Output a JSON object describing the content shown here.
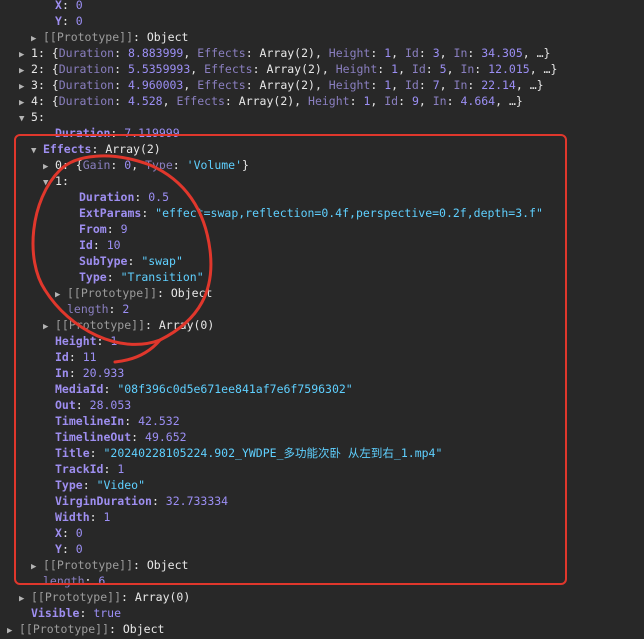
{
  "lines": [
    {
      "parts": [
        [
          "key",
          "X"
        ],
        [
          "txt",
          ": "
        ],
        [
          "num",
          "0"
        ]
      ]
    },
    {
      "parts": [
        [
          "key",
          "Y"
        ],
        [
          "txt",
          ": "
        ],
        [
          "num",
          "0"
        ]
      ]
    },
    {
      "parts": [
        [
          "proto",
          "[[Prototype]]"
        ],
        [
          "txt",
          ": "
        ],
        [
          "obj",
          "Object"
        ]
      ]
    },
    {
      "parts": [
        [
          "idx",
          "1"
        ],
        [
          "txt",
          ": {"
        ],
        [
          "key-dim",
          "Duration"
        ],
        [
          "txt",
          ": "
        ],
        [
          "num",
          "8.883999"
        ],
        [
          "txt",
          ", "
        ],
        [
          "key-dim",
          "Effects"
        ],
        [
          "txt",
          ": "
        ],
        [
          "obj",
          "Array(2)"
        ],
        [
          "txt",
          ", "
        ],
        [
          "key-dim",
          "Height"
        ],
        [
          "txt",
          ": "
        ],
        [
          "num",
          "1"
        ],
        [
          "txt",
          ", "
        ],
        [
          "key-dim",
          "Id"
        ],
        [
          "txt",
          ": "
        ],
        [
          "num",
          "3"
        ],
        [
          "txt",
          ", "
        ],
        [
          "key-dim",
          "In"
        ],
        [
          "txt",
          ": "
        ],
        [
          "num",
          "34.305"
        ],
        [
          "txt",
          ", …}"
        ]
      ]
    },
    {
      "parts": [
        [
          "idx",
          "2"
        ],
        [
          "txt",
          ": {"
        ],
        [
          "key-dim",
          "Duration"
        ],
        [
          "txt",
          ": "
        ],
        [
          "num",
          "5.5359993"
        ],
        [
          "txt",
          ", "
        ],
        [
          "key-dim",
          "Effects"
        ],
        [
          "txt",
          ": "
        ],
        [
          "obj",
          "Array(2)"
        ],
        [
          "txt",
          ", "
        ],
        [
          "key-dim",
          "Height"
        ],
        [
          "txt",
          ": "
        ],
        [
          "num",
          "1"
        ],
        [
          "txt",
          ", "
        ],
        [
          "key-dim",
          "Id"
        ],
        [
          "txt",
          ": "
        ],
        [
          "num",
          "5"
        ],
        [
          "txt",
          ", "
        ],
        [
          "key-dim",
          "In"
        ],
        [
          "txt",
          ": "
        ],
        [
          "num",
          "12.015"
        ],
        [
          "txt",
          ", …}"
        ]
      ]
    },
    {
      "parts": [
        [
          "idx",
          "3"
        ],
        [
          "txt",
          ": {"
        ],
        [
          "key-dim",
          "Duration"
        ],
        [
          "txt",
          ": "
        ],
        [
          "num",
          "4.960003"
        ],
        [
          "txt",
          ", "
        ],
        [
          "key-dim",
          "Effects"
        ],
        [
          "txt",
          ": "
        ],
        [
          "obj",
          "Array(2)"
        ],
        [
          "txt",
          ", "
        ],
        [
          "key-dim",
          "Height"
        ],
        [
          "txt",
          ": "
        ],
        [
          "num",
          "1"
        ],
        [
          "txt",
          ", "
        ],
        [
          "key-dim",
          "Id"
        ],
        [
          "txt",
          ": "
        ],
        [
          "num",
          "7"
        ],
        [
          "txt",
          ", "
        ],
        [
          "key-dim",
          "In"
        ],
        [
          "txt",
          ": "
        ],
        [
          "num",
          "22.14"
        ],
        [
          "txt",
          ", …}"
        ]
      ]
    },
    {
      "parts": [
        [
          "idx",
          "4"
        ],
        [
          "txt",
          ": {"
        ],
        [
          "key-dim",
          "Duration"
        ],
        [
          "txt",
          ": "
        ],
        [
          "num",
          "4.528"
        ],
        [
          "txt",
          ", "
        ],
        [
          "key-dim",
          "Effects"
        ],
        [
          "txt",
          ": "
        ],
        [
          "obj",
          "Array(2)"
        ],
        [
          "txt",
          ", "
        ],
        [
          "key-dim",
          "Height"
        ],
        [
          "txt",
          ": "
        ],
        [
          "num",
          "1"
        ],
        [
          "txt",
          ", "
        ],
        [
          "key-dim",
          "Id"
        ],
        [
          "txt",
          ": "
        ],
        [
          "num",
          "9"
        ],
        [
          "txt",
          ", "
        ],
        [
          "key-dim",
          "In"
        ],
        [
          "txt",
          ": "
        ],
        [
          "num",
          "4.664"
        ],
        [
          "txt",
          ", …}"
        ]
      ]
    },
    {
      "parts": [
        [
          "idx",
          "5"
        ],
        [
          "txt",
          ":"
        ]
      ]
    },
    {
      "parts": [
        [
          "key",
          "Duration"
        ],
        [
          "txt",
          ": "
        ],
        [
          "num",
          "7.119999"
        ]
      ]
    },
    {
      "parts": [
        [
          "key",
          "Effects"
        ],
        [
          "txt",
          ": "
        ],
        [
          "obj",
          "Array(2)"
        ]
      ]
    },
    {
      "parts": [
        [
          "idx",
          "0"
        ],
        [
          "txt",
          ": {"
        ],
        [
          "key-dim",
          "Gain"
        ],
        [
          "txt",
          ": "
        ],
        [
          "num",
          "0"
        ],
        [
          "txt",
          ", "
        ],
        [
          "key-dim",
          "Type"
        ],
        [
          "txt",
          ": "
        ],
        [
          "str",
          "'Volume'"
        ],
        [
          "txt",
          "}"
        ]
      ]
    },
    {
      "parts": [
        [
          "idx",
          "1"
        ],
        [
          "txt",
          ":"
        ]
      ]
    },
    {
      "parts": [
        [
          "key",
          "Duration"
        ],
        [
          "txt",
          ": "
        ],
        [
          "num",
          "0.5"
        ]
      ]
    },
    {
      "parts": [
        [
          "key",
          "ExtParams"
        ],
        [
          "txt",
          ": "
        ],
        [
          "str",
          "\"effect=swap,reflection=0.4f,perspective=0.2f,depth=3.f\""
        ]
      ]
    },
    {
      "parts": [
        [
          "key",
          "From"
        ],
        [
          "txt",
          ": "
        ],
        [
          "num",
          "9"
        ]
      ]
    },
    {
      "parts": [
        [
          "key",
          "Id"
        ],
        [
          "txt",
          ": "
        ],
        [
          "num",
          "10"
        ]
      ]
    },
    {
      "parts": [
        [
          "key",
          "SubType"
        ],
        [
          "txt",
          ": "
        ],
        [
          "str",
          "\"swap\""
        ]
      ]
    },
    {
      "parts": [
        [
          "key",
          "Type"
        ],
        [
          "txt",
          ": "
        ],
        [
          "str",
          "\"Transition\""
        ]
      ]
    },
    {
      "parts": [
        [
          "proto",
          "[[Prototype]]"
        ],
        [
          "txt",
          ": "
        ],
        [
          "obj",
          "Object"
        ]
      ]
    },
    {
      "parts": [
        [
          "key-dim",
          "length"
        ],
        [
          "txt",
          ": "
        ],
        [
          "num",
          "2"
        ]
      ]
    },
    {
      "parts": [
        [
          "proto",
          "[[Prototype]]"
        ],
        [
          "txt",
          ": "
        ],
        [
          "obj",
          "Array(0)"
        ]
      ]
    },
    {
      "parts": [
        [
          "key",
          "Height"
        ],
        [
          "txt",
          ": "
        ],
        [
          "num",
          "1"
        ]
      ]
    },
    {
      "parts": [
        [
          "key",
          "Id"
        ],
        [
          "txt",
          ": "
        ],
        [
          "num",
          "11"
        ]
      ]
    },
    {
      "parts": [
        [
          "key",
          "In"
        ],
        [
          "txt",
          ": "
        ],
        [
          "num",
          "20.933"
        ]
      ]
    },
    {
      "parts": [
        [
          "key",
          "MediaId"
        ],
        [
          "txt",
          ": "
        ],
        [
          "str",
          "\"08f396c0d5e671ee841af7e6f7596302\""
        ]
      ]
    },
    {
      "parts": [
        [
          "key",
          "Out"
        ],
        [
          "txt",
          ": "
        ],
        [
          "num",
          "28.053"
        ]
      ]
    },
    {
      "parts": [
        [
          "key",
          "TimelineIn"
        ],
        [
          "txt",
          ": "
        ],
        [
          "num",
          "42.532"
        ]
      ]
    },
    {
      "parts": [
        [
          "key",
          "TimelineOut"
        ],
        [
          "txt",
          ": "
        ],
        [
          "num",
          "49.652"
        ]
      ]
    },
    {
      "parts": [
        [
          "key",
          "Title"
        ],
        [
          "txt",
          ": "
        ],
        [
          "str",
          "\"20240228105224.902_YWDPE_多功能次卧 从左到右_1.mp4\""
        ]
      ]
    },
    {
      "parts": [
        [
          "key",
          "TrackId"
        ],
        [
          "txt",
          ": "
        ],
        [
          "num",
          "1"
        ]
      ]
    },
    {
      "parts": [
        [
          "key",
          "Type"
        ],
        [
          "txt",
          ": "
        ],
        [
          "str",
          "\"Video\""
        ]
      ]
    },
    {
      "parts": [
        [
          "key",
          "VirginDuration"
        ],
        [
          "txt",
          ": "
        ],
        [
          "num",
          "32.733334"
        ]
      ]
    },
    {
      "parts": [
        [
          "key",
          "Width"
        ],
        [
          "txt",
          ": "
        ],
        [
          "num",
          "1"
        ]
      ]
    },
    {
      "parts": [
        [
          "key",
          "X"
        ],
        [
          "txt",
          ": "
        ],
        [
          "num",
          "0"
        ]
      ]
    },
    {
      "parts": [
        [
          "key",
          "Y"
        ],
        [
          "txt",
          ": "
        ],
        [
          "num",
          "0"
        ]
      ]
    },
    {
      "parts": [
        [
          "proto",
          "[[Prototype]]"
        ],
        [
          "txt",
          ": "
        ],
        [
          "obj",
          "Object"
        ]
      ]
    },
    {
      "parts": [
        [
          "key-dim",
          "length"
        ],
        [
          "txt",
          ": "
        ],
        [
          "num",
          "6"
        ]
      ]
    },
    {
      "parts": [
        [
          "proto",
          "[[Prototype]]"
        ],
        [
          "txt",
          ": "
        ],
        [
          "obj",
          "Array(0)"
        ]
      ]
    },
    {
      "parts": [
        [
          "key",
          "Visible"
        ],
        [
          "txt",
          ": "
        ],
        [
          "num",
          "true"
        ]
      ]
    },
    {
      "parts": [
        [
          "proto",
          "[[Prototype]]"
        ],
        [
          "txt",
          ": "
        ],
        [
          "obj",
          "Object"
        ]
      ]
    }
  ],
  "toggles": [
    "none",
    "none",
    "collapsed",
    "collapsed",
    "collapsed",
    "collapsed",
    "collapsed",
    "expanded",
    "none",
    "expanded",
    "collapsed",
    "expanded",
    "none",
    "none",
    "none",
    "none",
    "none",
    "none",
    "collapsed",
    "none",
    "collapsed",
    "none",
    "none",
    "none",
    "none",
    "none",
    "none",
    "none",
    "none",
    "none",
    "none",
    "none",
    "none",
    "none",
    "none",
    "collapsed",
    "none",
    "collapsed",
    "none",
    "collapsed"
  ],
  "colors": {
    "background": "#282828",
    "annotation": "#e0372c",
    "key": "#9e8ef0",
    "number": "#9c8ff5",
    "string": "#5fd0ff"
  }
}
